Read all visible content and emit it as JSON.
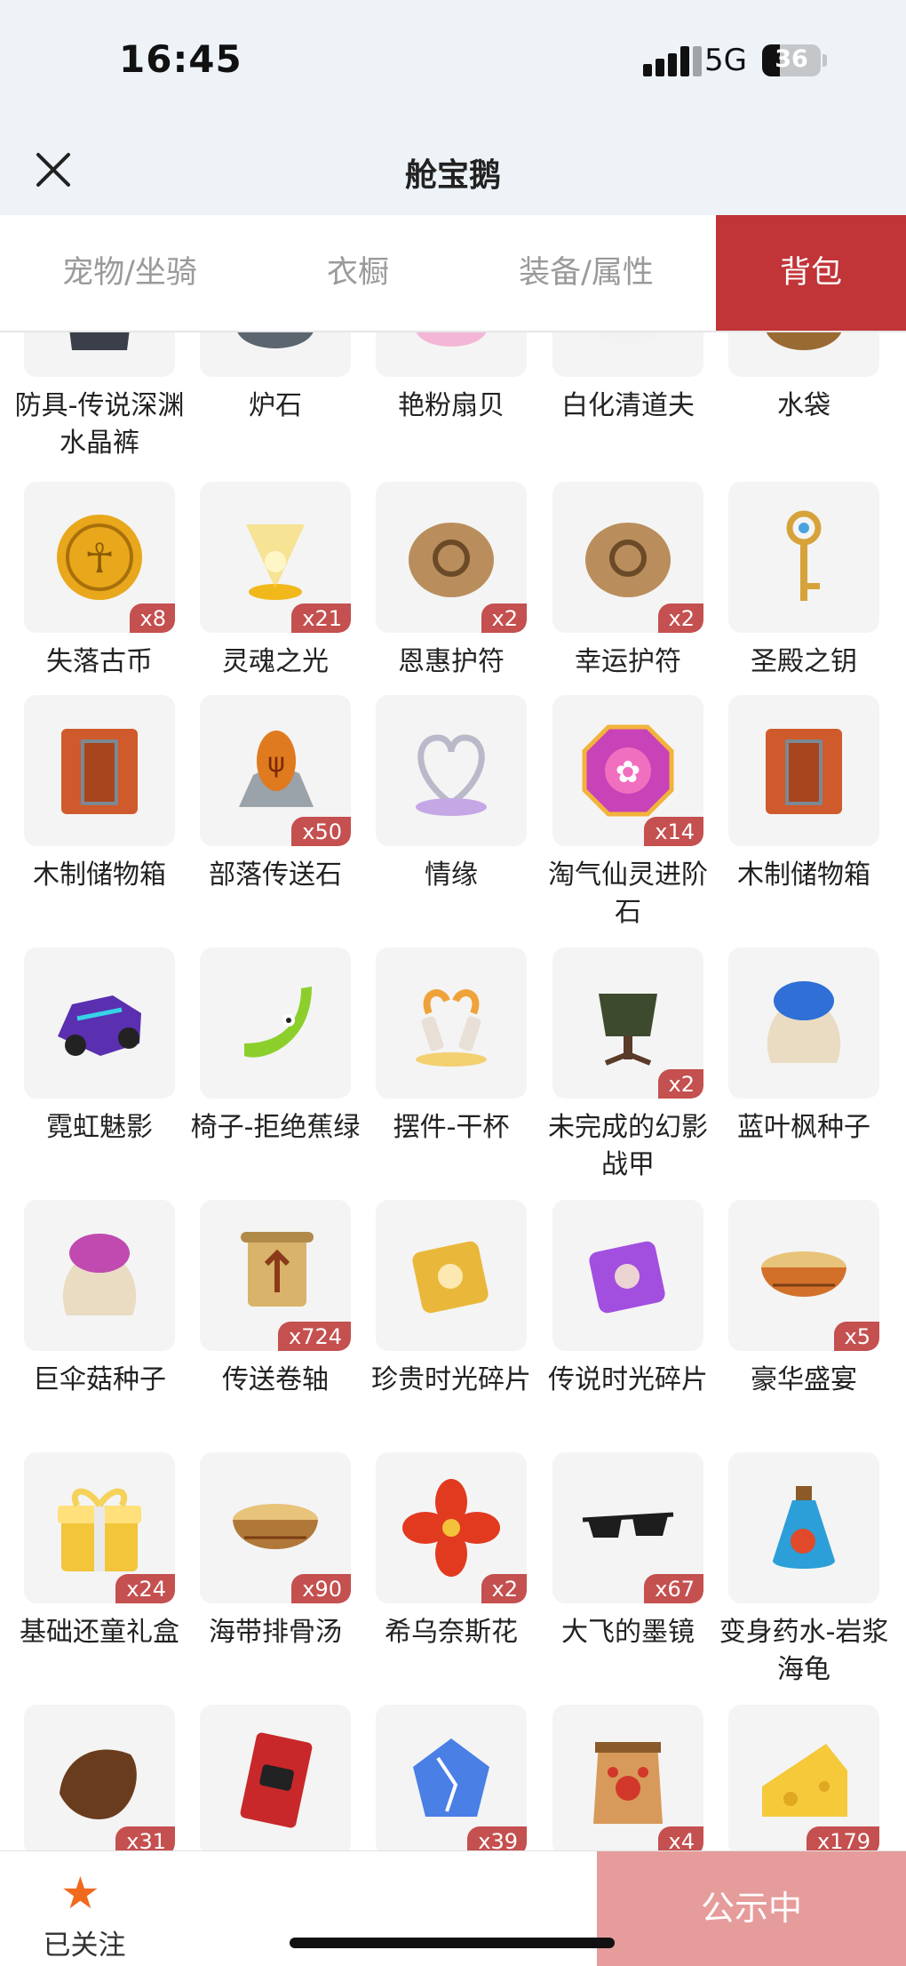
{
  "status_bar": {
    "time": "16:45",
    "network": "5G",
    "battery": "36"
  },
  "header": {
    "title": "舱宝鹅"
  },
  "tabs": [
    {
      "label": "宠物/坐骑",
      "active": false
    },
    {
      "label": "衣橱",
      "active": false
    },
    {
      "label": "装备/属性",
      "active": false
    },
    {
      "label": "背包",
      "active": true
    }
  ],
  "items": [
    {
      "name": "防具-传说深渊水晶裤",
      "count": "",
      "icon": "armor-icon",
      "color": "#3a3f4a"
    },
    {
      "name": "炉石",
      "count": "",
      "icon": "hearthstone-icon",
      "color": "#5b6570"
    },
    {
      "name": "艳粉扇贝",
      "count": "",
      "icon": "shell-icon",
      "color": "#f3b6d6"
    },
    {
      "name": "白化清道夫",
      "count": "",
      "icon": "fish-icon",
      "color": "#f2f2f2"
    },
    {
      "name": "水袋",
      "count": "",
      "icon": "water-bag-icon",
      "color": "#9a6a33"
    },
    {
      "name": "失落古币",
      "count": "x8",
      "icon": "coin-icon",
      "color": "#e9a71b"
    },
    {
      "name": "灵魂之光",
      "count": "x21",
      "icon": "soul-light-icon",
      "color": "#f7d544"
    },
    {
      "name": "恩惠护符",
      "count": "x2",
      "icon": "amulet-icon",
      "color": "#b98e5c"
    },
    {
      "name": "幸运护符",
      "count": "x2",
      "icon": "amulet-icon",
      "color": "#b98e5c"
    },
    {
      "name": "圣殿之钥",
      "count": "",
      "icon": "key-icon",
      "color": "#d6a23a"
    },
    {
      "name": "木制储物箱",
      "count": "",
      "icon": "crate-icon",
      "color": "#cf5a2b"
    },
    {
      "name": "部落传送石",
      "count": "x50",
      "icon": "teleport-stone-icon",
      "color": "#e07a1e"
    },
    {
      "name": "情缘",
      "count": "",
      "icon": "heart-ornament-icon",
      "color": "#c6a7e6"
    },
    {
      "name": "淘气仙灵进阶石",
      "count": "x14",
      "icon": "gem-icon",
      "color": "#c842b8"
    },
    {
      "name": "木制储物箱",
      "count": "",
      "icon": "crate-icon",
      "color": "#cf5a2b"
    },
    {
      "name": "霓虹魅影",
      "count": "",
      "icon": "vehicle-icon",
      "color": "#5a2fb0"
    },
    {
      "name": "椅子-拒绝蕉绿",
      "count": "",
      "icon": "banana-icon",
      "color": "#8ccf2c"
    },
    {
      "name": "摆件-干杯",
      "count": "",
      "icon": "toast-icon",
      "color": "#f0a23a"
    },
    {
      "name": "未完成的幻影战甲",
      "count": "x2",
      "icon": "armor-stand-icon",
      "color": "#3e4a2e"
    },
    {
      "name": "蓝叶枫种子",
      "count": "",
      "icon": "seed-bag-icon",
      "color": "#2f6fd6"
    },
    {
      "name": "巨伞菇种子",
      "count": "",
      "icon": "seed-bag-icon",
      "color": "#c04ab0"
    },
    {
      "name": "传送卷轴",
      "count": "x724",
      "icon": "scroll-icon",
      "color": "#d9b36a"
    },
    {
      "name": "珍贵时光碎片",
      "count": "",
      "icon": "puzzle-icon",
      "color": "#e9b83a"
    },
    {
      "name": "传说时光碎片",
      "count": "",
      "icon": "puzzle-icon",
      "color": "#a24fe0"
    },
    {
      "name": "豪华盛宴",
      "count": "x5",
      "icon": "bowl-icon",
      "color": "#d2702a"
    },
    {
      "name": "基础还童礼盒",
      "count": "x24",
      "icon": "gift-box-icon",
      "color": "#f2c53a"
    },
    {
      "name": "海带排骨汤",
      "count": "x90",
      "icon": "bowl-icon",
      "color": "#b07838"
    },
    {
      "name": "希乌奈斯花",
      "count": "x2",
      "icon": "flower-icon",
      "color": "#e23a1f"
    },
    {
      "name": "大飞的墨镜",
      "count": "x67",
      "icon": "sunglasses-icon",
      "color": "#1d1d1d"
    },
    {
      "name": "变身药水-岩浆海龟",
      "count": "",
      "icon": "potion-icon",
      "color": "#2c9fd8"
    },
    {
      "name": "",
      "count": "x31",
      "icon": "leather-icon",
      "color": "#6a3c1e"
    },
    {
      "name": "",
      "count": "",
      "icon": "card-icon",
      "color": "#c8282a"
    },
    {
      "name": "",
      "count": "x39",
      "icon": "crystal-icon",
      "color": "#4a7fe6"
    },
    {
      "name": "",
      "count": "x4",
      "icon": "pet-food-icon",
      "color": "#d89a5a"
    },
    {
      "name": "",
      "count": "x179",
      "icon": "cheese-icon",
      "color": "#f6c93a"
    }
  ],
  "bottom_bar": {
    "follow_label": "已关注",
    "status_label": "公示中"
  }
}
